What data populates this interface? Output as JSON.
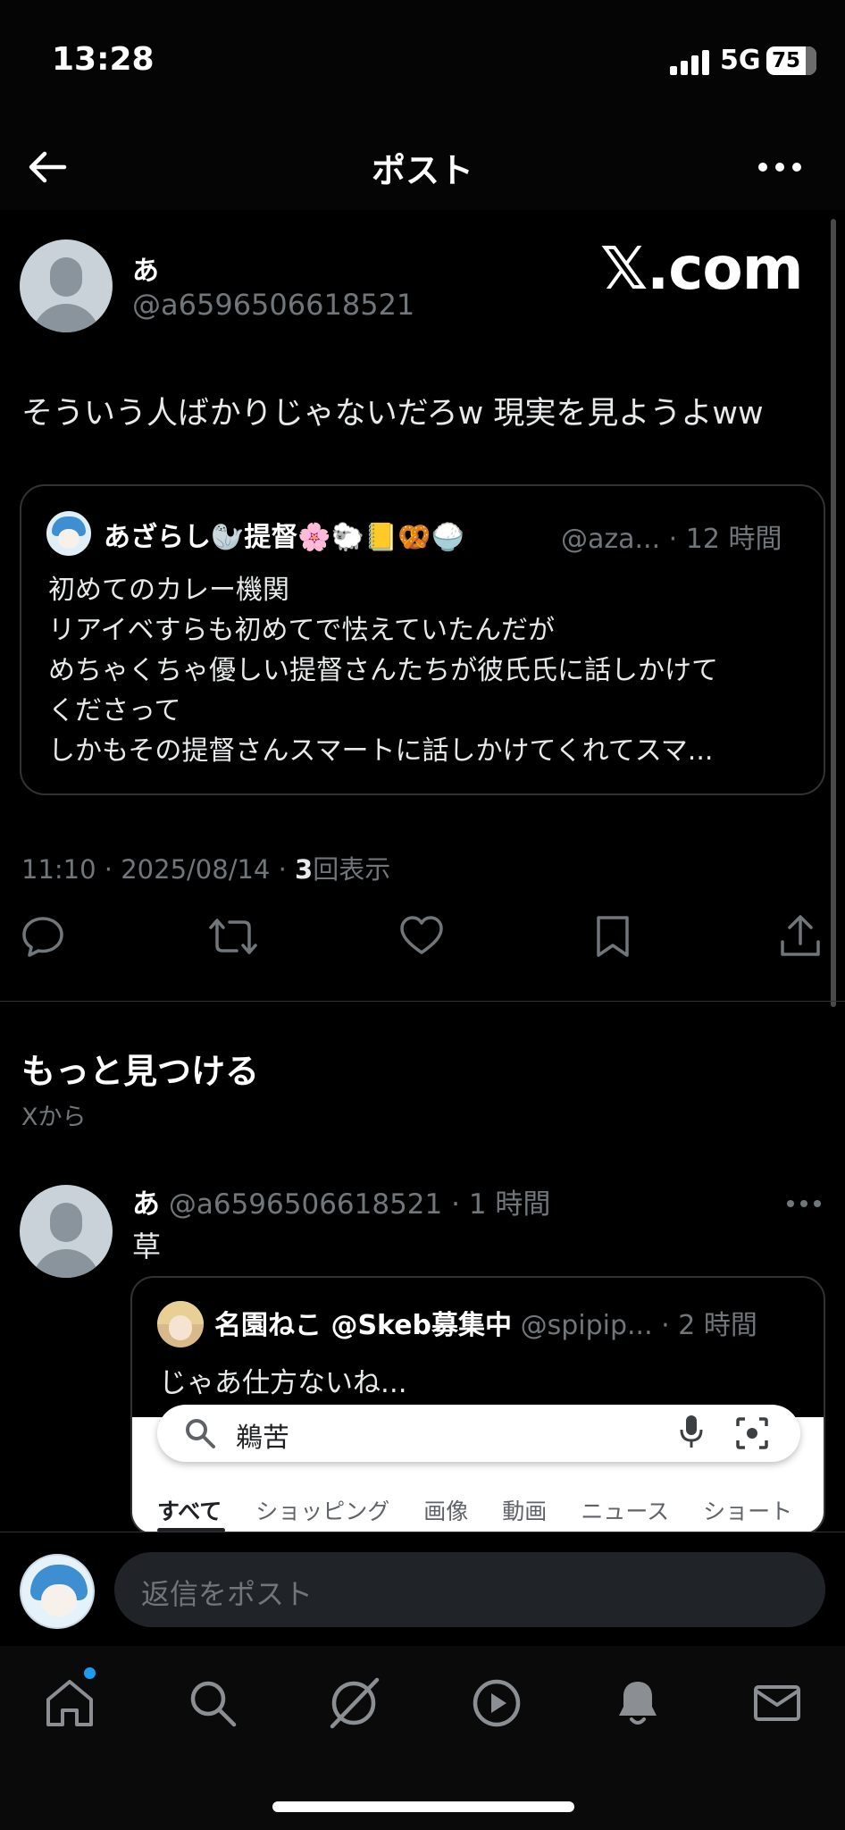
{
  "status_bar": {
    "time": "13:28",
    "network": "5G",
    "battery": "75"
  },
  "header": {
    "title": "ポスト"
  },
  "post": {
    "author_name": "あ",
    "author_handle": "@a6596506618521",
    "watermark": "𝕏.com",
    "text": "そういう人ばかりじゃないだろw 現実を見ようよww",
    "quote": {
      "author_name": "あざらし🦭提督🌸🐑📒🥨🍚",
      "author_handle": "@aza...",
      "time": "· 12 時間",
      "lines": [
        "初めてのカレー機関",
        "リアイベすらも初めてで怯えていたんだが",
        "めちゃくちゃ優しい提督さんたちが彼氏氏に話しかけて",
        "くださって",
        "しかもその提督さんスマートに話しかけてくれてスマ..."
      ]
    },
    "meta_time": "11:10 · 2025/08/14 · ",
    "meta_views_count": "3",
    "meta_views_label": "回表示"
  },
  "discover": {
    "title": "もっと見つける",
    "subtitle": "Xから"
  },
  "post2": {
    "author_name": "あ",
    "author_handle": " @a6596506618521 · 1 時間",
    "text": "草",
    "quote": {
      "author_name": "名園ねこ @Skeb募集中",
      "author_handle": " @spipip... · 2 時間",
      "text": "じゃあ仕方ないね...",
      "embed": {
        "search_query": "鵜苦",
        "tabs": [
          "すべて",
          "ショッピング",
          "画像",
          "動画",
          "ニュース",
          "ショート"
        ]
      }
    }
  },
  "reply": {
    "placeholder": "返信をポスト"
  }
}
